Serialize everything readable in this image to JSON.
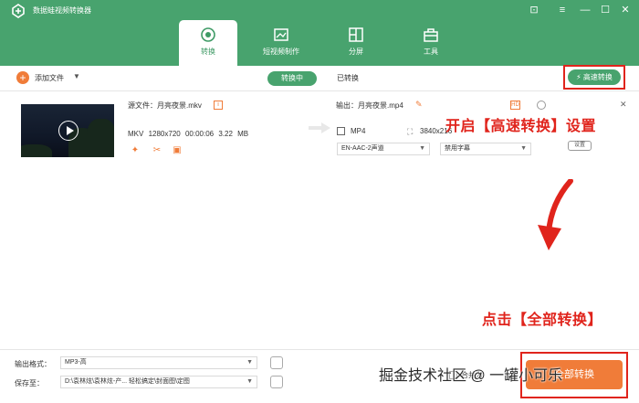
{
  "app": {
    "title": "数据蛙视频转换器"
  },
  "tabs": [
    {
      "label": "转换",
      "icon": "convert-icon",
      "active": true
    },
    {
      "label": "短视频制作",
      "icon": "video-maker-icon",
      "active": false
    },
    {
      "label": "分屏",
      "icon": "split-screen-icon",
      "active": false
    },
    {
      "label": "工具",
      "icon": "toolbox-icon",
      "active": false
    }
  ],
  "toolbar": {
    "add_file": "添加文件",
    "converting": "转换中",
    "converted": "已转换",
    "fast_convert": "高速转换"
  },
  "file": {
    "source_label": "源文件：月亮夜景.mkv",
    "format": "MKV",
    "resolution": "1280x720",
    "duration": "00:00:06",
    "size": "3.22 MB",
    "output_label": "输出：月亮夜景.mp4",
    "out_format": "MP4",
    "out_resolution": "3840x216",
    "audio_track": "EN-AAC-2声道",
    "subtitle": "禁用字幕",
    "settings": "设置"
  },
  "annotations": {
    "top": "开启【高速转换】设置",
    "bottom": "点击【全部转换】"
  },
  "bottom": {
    "output_format_label": "输出格式：",
    "output_format_value": "MP3-高",
    "save_to_label": "保存至：",
    "save_path": "D:\\袁林炫\\袁林炫-产...  轻松搞定\\封面图\\定图",
    "merge_label": "合并为",
    "convert_all": "全部转换"
  },
  "watermark": "掘金技术社区 @ 一罐小可乐",
  "colors": {
    "brand": "#48a36e",
    "accent": "#f07c39",
    "annotation": "#e0241c"
  }
}
